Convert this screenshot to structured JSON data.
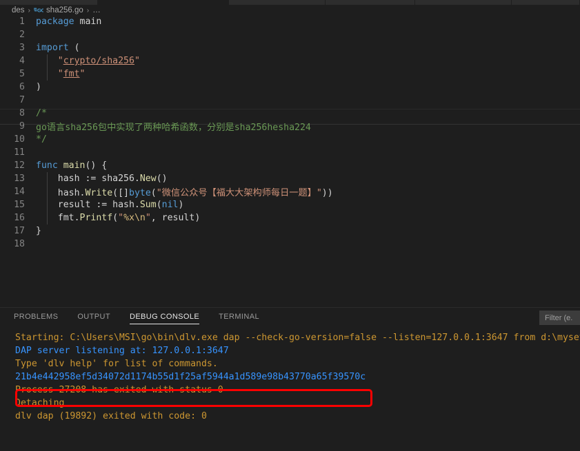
{
  "window": {
    "theme_bg": "#1e1e1e",
    "accent": "#007acc"
  },
  "breadcrumb": {
    "root": "des",
    "sep1": "›",
    "file": "sha256.go",
    "file_icon": "go-language-icon",
    "sep2": "›",
    "overflow": "…"
  },
  "editor": {
    "language": "go",
    "lines": [
      {
        "n": "1",
        "tokens": [
          {
            "t": "package ",
            "c": "kw"
          },
          {
            "t": "main",
            "c": "plain"
          }
        ]
      },
      {
        "n": "2",
        "tokens": []
      },
      {
        "n": "3",
        "tokens": [
          {
            "t": "import",
            "c": "kw"
          },
          {
            "t": " (",
            "c": "plain"
          }
        ]
      },
      {
        "n": "4",
        "indent": true,
        "tokens": [
          {
            "t": "    ",
            "c": "plain"
          },
          {
            "t": "\"",
            "c": "str"
          },
          {
            "t": "crypto/sha256",
            "c": "strlink"
          },
          {
            "t": "\"",
            "c": "str"
          }
        ]
      },
      {
        "n": "5",
        "indent": true,
        "tokens": [
          {
            "t": "    ",
            "c": "plain"
          },
          {
            "t": "\"",
            "c": "str"
          },
          {
            "t": "fmt",
            "c": "strlink"
          },
          {
            "t": "\"",
            "c": "str"
          }
        ]
      },
      {
        "n": "6",
        "tokens": [
          {
            "t": ")",
            "c": "plain"
          }
        ]
      },
      {
        "n": "7",
        "tokens": []
      },
      {
        "n": "8",
        "tokens": [
          {
            "t": "/*",
            "c": "cmt"
          }
        ]
      },
      {
        "n": "9",
        "tokens": [
          {
            "t": "go语言sha256包中实现了两种哈希函数，分别是sha256hesha224",
            "c": "cmt"
          }
        ]
      },
      {
        "n": "10",
        "tokens": [
          {
            "t": "*/",
            "c": "cmt"
          }
        ]
      },
      {
        "n": "11",
        "tokens": []
      },
      {
        "n": "12",
        "tokens": [
          {
            "t": "func ",
            "c": "kw"
          },
          {
            "t": "main",
            "c": "fn"
          },
          {
            "t": "() {",
            "c": "plain"
          }
        ]
      },
      {
        "n": "13",
        "indent": true,
        "tokens": [
          {
            "t": "    hash := sha256.",
            "c": "plain"
          },
          {
            "t": "New",
            "c": "fn"
          },
          {
            "t": "()",
            "c": "plain"
          }
        ]
      },
      {
        "n": "14",
        "indent": true,
        "tokens": [
          {
            "t": "    hash.",
            "c": "plain"
          },
          {
            "t": "Write",
            "c": "fn"
          },
          {
            "t": "([]",
            "c": "plain"
          },
          {
            "t": "byte",
            "c": "kw"
          },
          {
            "t": "(",
            "c": "plain"
          },
          {
            "t": "\"微信公众号【福大大架构师每日一题】\"",
            "c": "str"
          },
          {
            "t": "))",
            "c": "plain"
          }
        ]
      },
      {
        "n": "15",
        "indent": true,
        "tokens": [
          {
            "t": "    result := hash.",
            "c": "plain"
          },
          {
            "t": "Sum",
            "c": "fn"
          },
          {
            "t": "(",
            "c": "plain"
          },
          {
            "t": "nil",
            "c": "nilv"
          },
          {
            "t": ")",
            "c": "plain"
          }
        ]
      },
      {
        "n": "16",
        "indent": true,
        "tokens": [
          {
            "t": "    fmt.",
            "c": "plain"
          },
          {
            "t": "Printf",
            "c": "fn"
          },
          {
            "t": "(",
            "c": "plain"
          },
          {
            "t": "\"",
            "c": "str"
          },
          {
            "t": "%x\\n",
            "c": "esc"
          },
          {
            "t": "\"",
            "c": "str"
          },
          {
            "t": ", result)",
            "c": "plain"
          }
        ]
      },
      {
        "n": "17",
        "tokens": [
          {
            "t": "}",
            "c": "plain"
          }
        ]
      },
      {
        "n": "18",
        "tokens": []
      }
    ]
  },
  "panel": {
    "tabs": [
      {
        "label": "PROBLEMS",
        "active": false
      },
      {
        "label": "OUTPUT",
        "active": false
      },
      {
        "label": "DEBUG CONSOLE",
        "active": true
      },
      {
        "label": "TERMINAL",
        "active": false
      }
    ],
    "filter_placeholder": "Filter (e.",
    "console_lines": [
      {
        "text": "Starting: C:\\Users\\MSI\\go\\bin\\dlv.exe dap --check-go-version=false --listen=127.0.0.1:3647 from d:\\mysetu",
        "color": "c-yellow"
      },
      {
        "text": "DAP server listening at: 127.0.0.1:3647",
        "color": "c-blue"
      },
      {
        "text": "Type 'dlv help' for list of commands.",
        "color": "c-yellow"
      },
      {
        "text": "21b4e442958ef5d34072d1174b55d1f25af5944a1d589e98b43770a65f39570c",
        "color": "c-blue"
      },
      {
        "text": "Process 27208 has exited with status 0",
        "color": "c-yellow"
      },
      {
        "text": "Detaching",
        "color": "c-yellow"
      },
      {
        "text": "dlv dap (19892) exited with code: 0",
        "color": "c-yellow"
      }
    ],
    "annotation": {
      "shape": "rectangle",
      "color": "#ff0000",
      "target": "hash-output-line"
    }
  }
}
